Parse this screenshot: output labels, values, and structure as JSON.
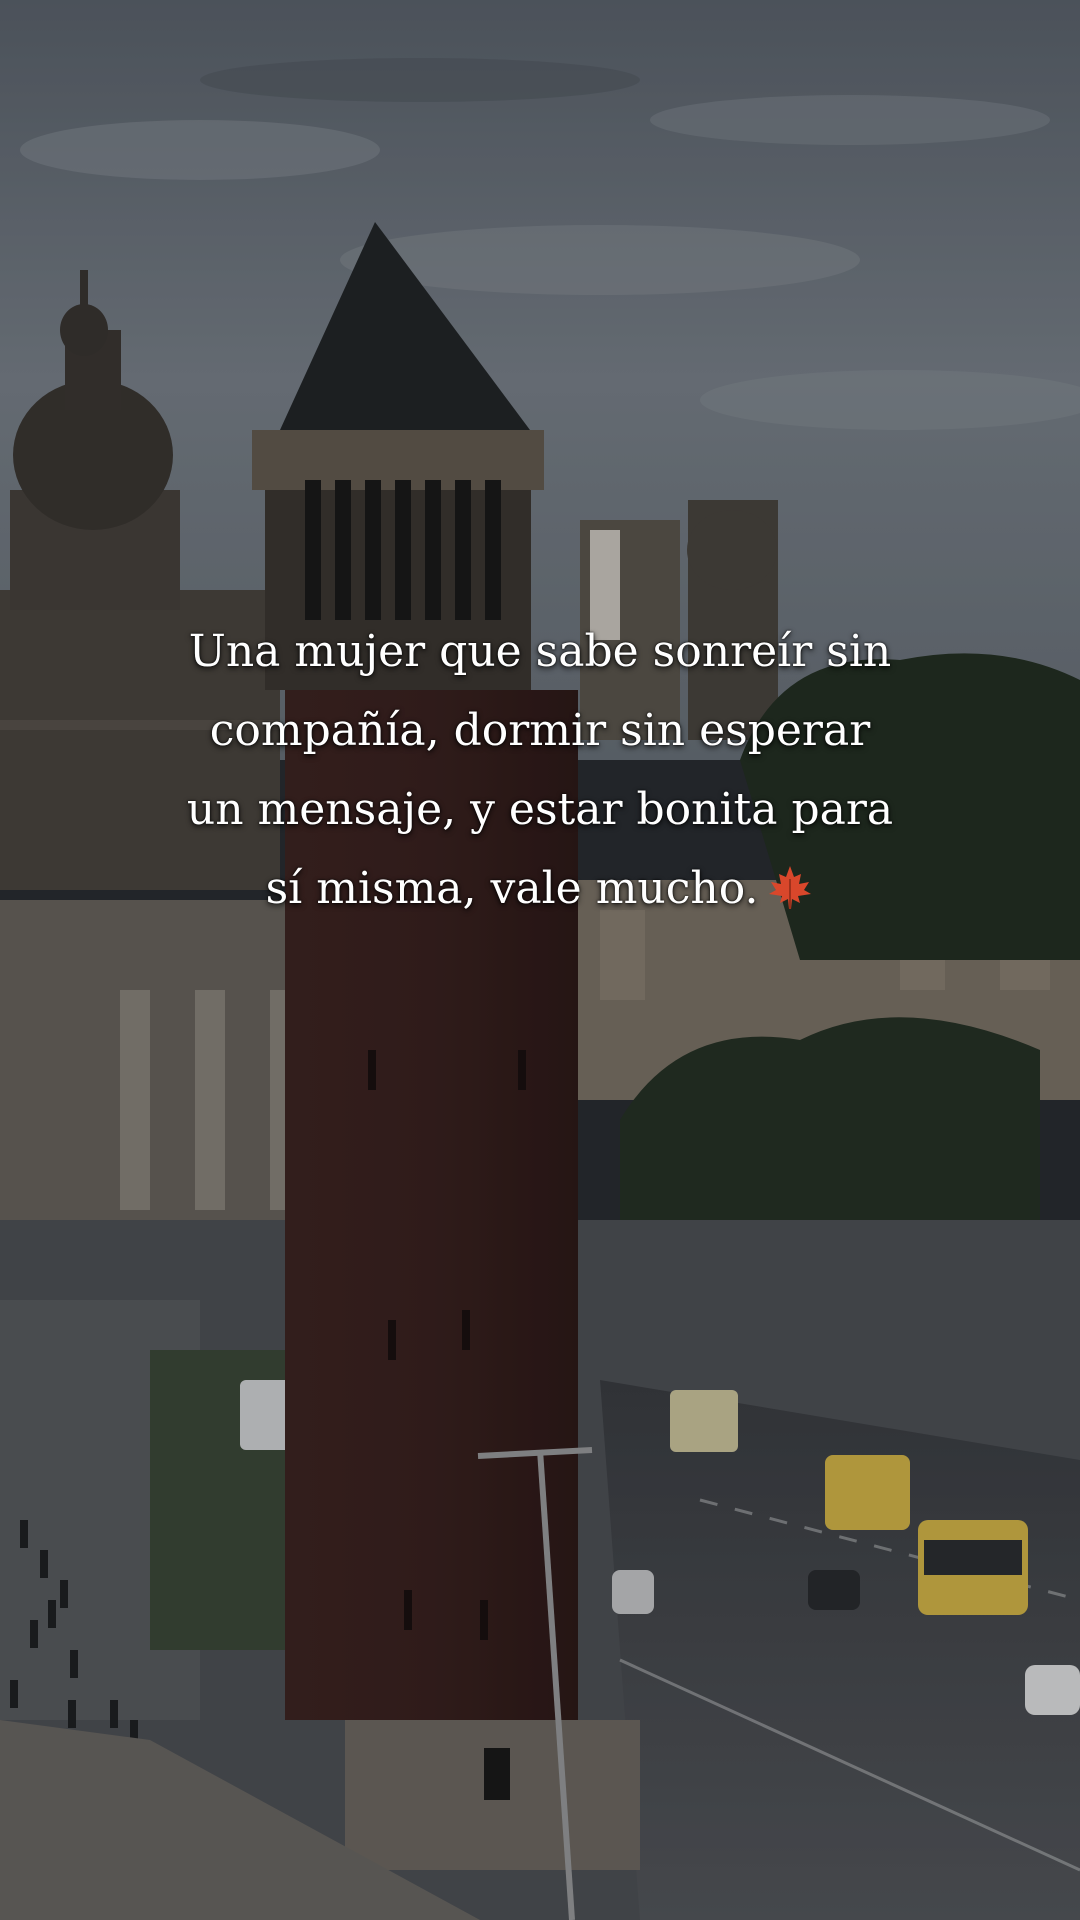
{
  "caption": {
    "lines": [
      "Una mujer que sabe sonreír sin",
      "compañía, dormir sin esperar",
      "un mensaje, y estar bonita para",
      "sí misma, vale mucho."
    ],
    "emoji_icon": "maple-leaf-icon"
  },
  "scene": {
    "description_icon": "city-plaza-photo",
    "colors": {
      "sky": "#6b737d",
      "tower": "#3a2422",
      "stone": "#7d7468",
      "road": "#4a4d52",
      "trees": "#243024",
      "bus": "#d6b84a"
    }
  }
}
